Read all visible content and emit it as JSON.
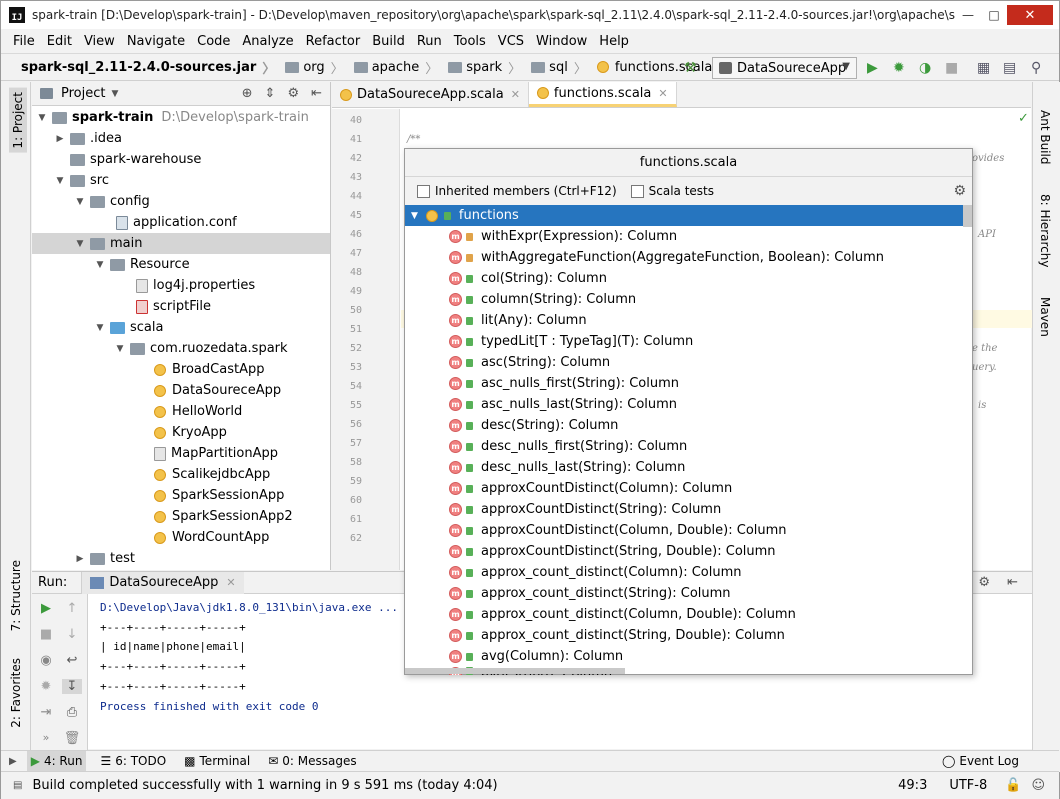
{
  "window": {
    "title": "spark-train [D:\\Develop\\spark-train] - D:\\Develop\\maven_repository\\org\\apache\\spark\\spark-sql_2.11\\2.4.0\\spark-sql_2.11-2.4.0-sources.jar!\\org\\apache\\spar...",
    "app_icon": "IJ"
  },
  "menu": [
    "File",
    "Edit",
    "View",
    "Navigate",
    "Code",
    "Analyze",
    "Refactor",
    "Build",
    "Run",
    "Tools",
    "VCS",
    "Window",
    "Help"
  ],
  "breadcrumb": [
    "spark-sql_2.11-2.4.0-sources.jar",
    "org",
    "apache",
    "spark",
    "sql",
    "functions.scala"
  ],
  "run_config": "DataSoureceApp",
  "left_tabs": {
    "project": "1: Project",
    "structure": "7: Structure",
    "favorites": "2: Favorites"
  },
  "right_tabs": {
    "ant": "Ant Build",
    "hierarchy": "8: Hierarchy",
    "maven": "Maven"
  },
  "project_panel": {
    "title": "Project",
    "tree": [
      {
        "label": "spark-train",
        "extra": "D:\\Develop\\spark-train",
        "bold": true
      },
      {
        "label": ".idea"
      },
      {
        "label": "spark-warehouse"
      },
      {
        "label": "src"
      },
      {
        "label": "config"
      },
      {
        "label": "application.conf"
      },
      {
        "label": "main"
      },
      {
        "label": "Resource"
      },
      {
        "label": "log4j.properties"
      },
      {
        "label": "scriptFile"
      },
      {
        "label": "scala"
      },
      {
        "label": "com.ruozedata.spark"
      },
      {
        "label": "BroadCastApp"
      },
      {
        "label": "DataSoureceApp"
      },
      {
        "label": "HelloWorld"
      },
      {
        "label": "KryoApp"
      },
      {
        "label": "MapPartitionApp"
      },
      {
        "label": "ScalikejdbcApp"
      },
      {
        "label": "SparkSessionApp"
      },
      {
        "label": "SparkSessionApp2"
      },
      {
        "label": "WordCountApp"
      },
      {
        "label": "test"
      }
    ]
  },
  "editor": {
    "tabs": [
      {
        "label": "DataSoureceApp.scala"
      },
      {
        "label": "functions.scala"
      }
    ],
    "line_numbers": [
      "40",
      "41",
      "42",
      "43",
      "44",
      "45",
      "46",
      "47",
      "48",
      "49",
      "50",
      "51",
      "52",
      "53",
      "54",
      "55",
      "56",
      "57",
      "58",
      "59",
      "60",
      "61",
      "62"
    ],
    "code_fragments": {
      "l41": "/**",
      "l42": "ovides",
      "l46": "API",
      "l52": "e the",
      "l53": "uery.",
      "l55": "is"
    }
  },
  "popup": {
    "title": "functions.scala",
    "inherited_label": "Inherited members (Ctrl+F12)",
    "scala_tests_label": "Scala tests",
    "root": "functions",
    "members": [
      {
        "label": "withExpr(Expression): Column",
        "locked": true
      },
      {
        "label": "withAggregateFunction(AggregateFunction, Boolean): Column",
        "locked": true
      },
      {
        "label": "col(String): Column"
      },
      {
        "label": "column(String): Column"
      },
      {
        "label": "lit(Any): Column"
      },
      {
        "label": "typedLit[T : TypeTag](T): Column"
      },
      {
        "label": "asc(String): Column"
      },
      {
        "label": "asc_nulls_first(String): Column"
      },
      {
        "label": "asc_nulls_last(String): Column"
      },
      {
        "label": "desc(String): Column"
      },
      {
        "label": "desc_nulls_first(String): Column"
      },
      {
        "label": "desc_nulls_last(String): Column"
      },
      {
        "label": "approxCountDistinct(Column): Column"
      },
      {
        "label": "approxCountDistinct(String): Column"
      },
      {
        "label": "approxCountDistinct(Column, Double): Column"
      },
      {
        "label": "approxCountDistinct(String, Double): Column"
      },
      {
        "label": "approx_count_distinct(Column): Column"
      },
      {
        "label": "approx_count_distinct(String): Column"
      },
      {
        "label": "approx_count_distinct(Column, Double): Column"
      },
      {
        "label": "approx_count_distinct(String, Double): Column"
      },
      {
        "label": "avg(Column): Column"
      },
      {
        "label": "avg(String): Column"
      }
    ]
  },
  "run_panel": {
    "label": "Run:",
    "tab": "DataSoureceApp",
    "console": [
      {
        "text": "D:\\Develop\\Java\\jdk1.8.0_131\\bin\\java.exe ..."
      },
      {
        "text": "+---+----+-----+-----+"
      },
      {
        "text": "| id|name|phone|email|"
      },
      {
        "text": "+---+----+-----+-----+"
      },
      {
        "text": "+---+----+-----+-----+"
      },
      {
        "text": ""
      },
      {
        "text": ""
      },
      {
        "text": "Process finished with exit code 0"
      }
    ]
  },
  "bottom_tabs": {
    "run": "4: Run",
    "todo": "6: TODO",
    "terminal": "Terminal",
    "messages": "0: Messages",
    "event_log": "Event Log"
  },
  "status": {
    "message": "Build completed successfully with 1 warning in 9 s 591 ms (today 4:04)",
    "position": "49:3",
    "encoding": "UTF-8"
  },
  "colors": {
    "selection": "#2675bf",
    "method_icon": "#f08080",
    "class_icon": "#f3c24a",
    "run_green": "#3c9a3c"
  }
}
